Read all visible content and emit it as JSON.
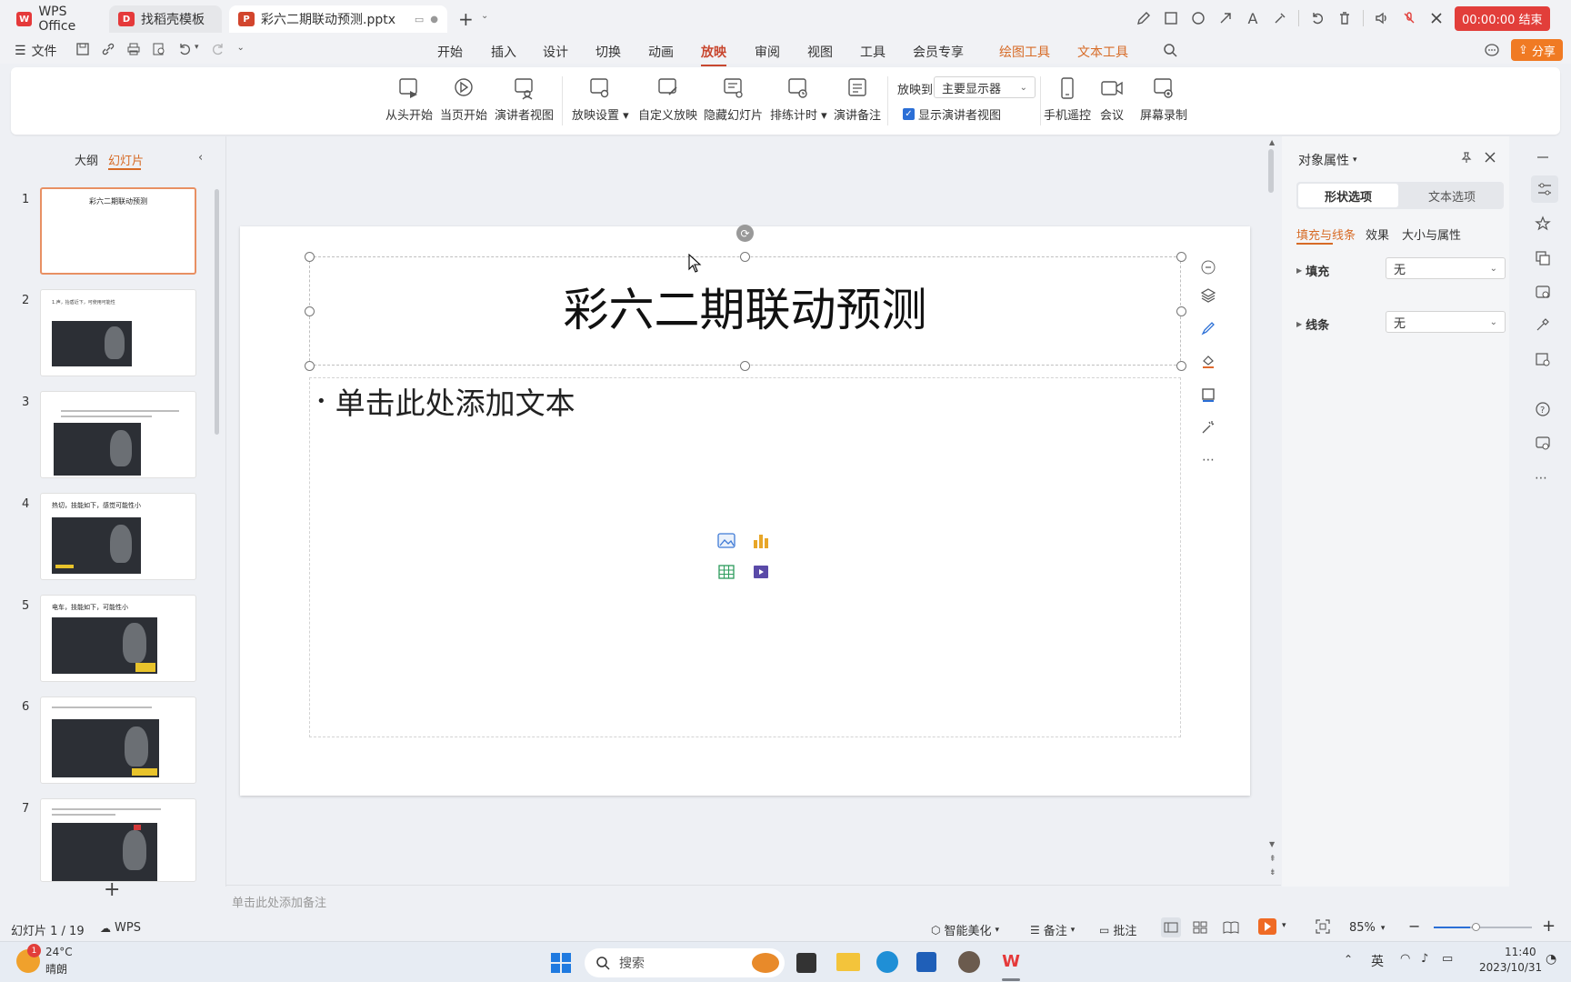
{
  "titlebar": {
    "tabs": [
      {
        "label": "WPS Office",
        "logo": "W"
      },
      {
        "label": "找稻壳模板",
        "logo": "D"
      },
      {
        "label": "彩六二期联动预测.pptx",
        "logo": "P"
      }
    ],
    "timer": "00:00:00 结束"
  },
  "menubar": {
    "file": "文件",
    "items": [
      "开始",
      "插入",
      "设计",
      "切换",
      "动画",
      "放映",
      "审阅",
      "视图",
      "工具",
      "会员专享",
      "绘图工具",
      "文本工具"
    ],
    "active": "放映",
    "share": "分享"
  },
  "ribbon": {
    "buttons": [
      "从头开始",
      "当页开始",
      "演讲者视图",
      "放映设置",
      "自定义放映",
      "隐藏幻灯片",
      "排练计时",
      "演讲备注",
      "手机遥控",
      "会议",
      "屏幕录制"
    ],
    "play_to_label": "放映到",
    "play_to_value": "主要显示器",
    "presenter_view_checkbox": "显示演讲者视图"
  },
  "leftpanel": {
    "tab_outline": "大纲",
    "tab_slides": "幻灯片",
    "slides": [
      {
        "num": "1",
        "title": "彩六二期联动预测"
      },
      {
        "num": "2",
        "title": "1.声，抬盾近下，可使用可能性"
      },
      {
        "num": "3",
        "title": "2.…"
      },
      {
        "num": "4",
        "title": "热切，技能如下，感觉可能性小"
      },
      {
        "num": "5",
        "title": "电车，技能如下，可能性小"
      },
      {
        "num": "6",
        "title": "3.…"
      },
      {
        "num": "7",
        "title": "4.…"
      }
    ]
  },
  "slide": {
    "title": "彩六二期联动预测",
    "body_placeholder": "单击此处添加文本"
  },
  "notes_placeholder": "单击此处添加备注",
  "rightpanel": {
    "title": "对象属性",
    "tab_shape": "形状选项",
    "tab_text": "文本选项",
    "subtabs": [
      "填充与线条",
      "效果",
      "大小与属性"
    ],
    "fill_label": "填充",
    "fill_value": "无",
    "line_label": "线条",
    "line_value": "无"
  },
  "statusbar": {
    "slide_counter": "幻灯片 1 / 19",
    "wps": "WPS",
    "beautify": "智能美化",
    "notes": "备注",
    "comments": "批注",
    "zoom": "85%"
  },
  "taskbar": {
    "weather_temp": "24°C",
    "weather_desc": "晴朗",
    "weather_badge": "1",
    "search": "搜索",
    "lang": "英",
    "time": "11:40",
    "date": "2023/10/31"
  },
  "colors": {
    "accent": "#c8472f",
    "orange": "#d76b26",
    "timer_red": "#e23e3a",
    "wps_red": "#e5393a"
  }
}
